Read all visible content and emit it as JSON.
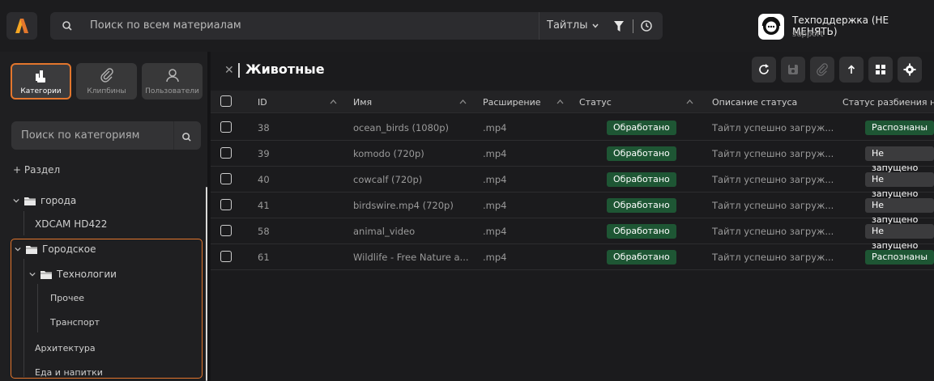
{
  "search": {
    "placeholder": "Поиск по всем материалам"
  },
  "filters": {
    "titles_label": "Тайтлы"
  },
  "user": {
    "name": "Техподдержка (НЕ МЕНЯТЬ)",
    "role": "support"
  },
  "sidebar": {
    "tabs": [
      {
        "label": "Категории",
        "active": true
      },
      {
        "label": "Клипбины",
        "active": false
      },
      {
        "label": "Пользователи",
        "active": false
      }
    ],
    "search_placeholder": "Поиск по категориям",
    "add_section_label": "+ Раздел",
    "tree": [
      {
        "label": "города",
        "expanded": true,
        "folder": true
      },
      {
        "label": "XDCAM HD422",
        "folder": false
      },
      {
        "label": "Городское",
        "expanded": true,
        "folder": true
      },
      {
        "label": "Технологии",
        "expanded": true,
        "folder": true
      },
      {
        "label": "Прочее",
        "folder": false
      },
      {
        "label": "Транспорт",
        "folder": false
      },
      {
        "label": "Архитектура",
        "folder": false
      },
      {
        "label": "Еда и напитки",
        "folder": false
      }
    ]
  },
  "main": {
    "title": "Животные",
    "columns": [
      "ID",
      "Имя",
      "Расширение",
      "Статус",
      "Описание статуса",
      "Статус разбиения на"
    ],
    "rows": [
      {
        "id": "38",
        "name": "ocean_birds (1080p)",
        "ext": ".mp4",
        "status": "Обработано",
        "desc": "Тайтл успешно загруж...",
        "split": "Распознаны"
      },
      {
        "id": "39",
        "name": "komodo (720p)",
        "ext": ".mp4",
        "status": "Обработано",
        "desc": "Тайтл успешно загруж...",
        "split": "Не запущено"
      },
      {
        "id": "40",
        "name": "cowcalf (720p)",
        "ext": ".mp4",
        "status": "Обработано",
        "desc": "Тайтл успешно загруж...",
        "split": "Не запущено"
      },
      {
        "id": "41",
        "name": "birdswire.mp4 (720p)",
        "ext": ".mp4",
        "status": "Обработано",
        "desc": "Тайтл успешно загруж...",
        "split": "Не запущено"
      },
      {
        "id": "58",
        "name": "animal_video",
        "ext": ".mp4",
        "status": "Обработано",
        "desc": "Тайтл успешно загруж...",
        "split": "Не запущено"
      },
      {
        "id": "61",
        "name": "Wildlife - Free Nature a...",
        "ext": ".mp4",
        "status": "Обработано",
        "desc": "Тайтл успешно загруж...",
        "split": "Распознаны"
      }
    ]
  },
  "colors": {
    "accent": "#e3762d",
    "success_badge": "#1e5634",
    "neutral_badge": "#3b3b3d"
  },
  "icons": [
    "logo-icon",
    "search-icon",
    "chevron-down-icon",
    "filter-icon",
    "history-icon",
    "support-chat-icon",
    "categories-icon",
    "clip-icon",
    "user-icon",
    "close-icon",
    "refresh-icon",
    "save-icon",
    "attach-icon",
    "upload-icon",
    "grid-icon",
    "settings-icon",
    "folder-icon",
    "checkbox-icon"
  ]
}
